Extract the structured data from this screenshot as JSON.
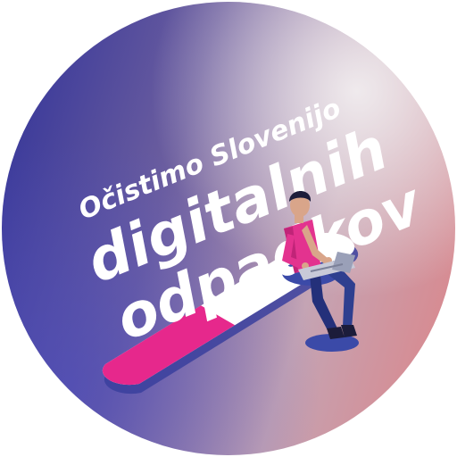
{
  "slogan": {
    "line1": "Očistimo Slovenijo",
    "line2": "digitalnih",
    "line3": "odpadkov"
  },
  "colors": {
    "gradient_start": "#3a3f9e",
    "gradient_mid": "#9a8ab0",
    "gradient_light": "#e8e0ea",
    "gradient_end": "#d98a93",
    "progress_fill": "#e6288c",
    "progress_track": "#ffffff",
    "shirt": "#e3338f",
    "trousers": "#2e3f8f"
  },
  "icons": [
    "person-with-laptop-icon"
  ],
  "progress": 0.45
}
